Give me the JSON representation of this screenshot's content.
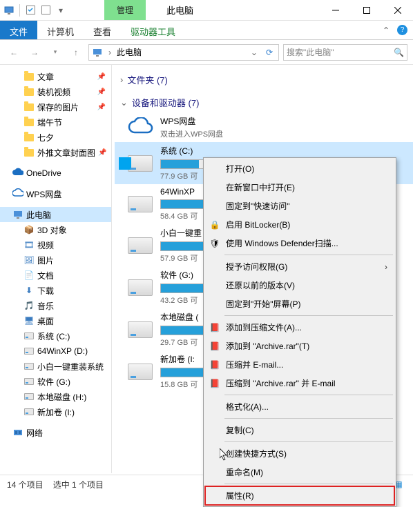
{
  "window": {
    "title": "此电脑",
    "manage_tab": "管理"
  },
  "ribbon": {
    "file": "文件",
    "computer": "计算机",
    "view": "查看",
    "tools": "驱动器工具"
  },
  "addr": {
    "path": "此电脑",
    "search_placeholder": "搜索\"此电脑\""
  },
  "tree": {
    "quick": [
      {
        "label": "文章",
        "pin": true
      },
      {
        "label": "装机视频",
        "pin": true
      },
      {
        "label": "保存的图片",
        "pin": true
      },
      {
        "label": "端午节"
      },
      {
        "label": "七夕"
      },
      {
        "label": "外推文章封面图",
        "pin": true
      }
    ],
    "onedrive": "OneDrive",
    "wps": "WPS网盘",
    "thispc": "此电脑",
    "thispc_children": [
      "3D 对象",
      "视频",
      "图片",
      "文档",
      "下载",
      "音乐",
      "桌面",
      "系统 (C:)",
      "64WinXP  (D:)",
      "小白一键重装系统",
      "软件 (G:)",
      "本地磁盘 (H:)",
      "新加卷 (I:)"
    ],
    "network": "网络"
  },
  "sections": {
    "folders": "文件夹 (7)",
    "drives": "设备和驱动器 (7)"
  },
  "wps_entry": {
    "title": "WPS网盘",
    "sub": "双击进入WPS网盘"
  },
  "drives": [
    {
      "title": "系统 (C:)",
      "sub": "77.9 GB 可",
      "fill": 35,
      "selected": true,
      "win": true
    },
    {
      "title": "64WinXP",
      "sub": "58.4 GB 可",
      "fill": 40
    },
    {
      "title": "小白一键重",
      "sub": "57.9 GB 可",
      "fill": 42
    },
    {
      "title": "软件 (G:)",
      "sub": "43.2 GB 可",
      "fill": 55
    },
    {
      "title": "本地磁盘 (",
      "sub": "29.7 GB 可",
      "fill": 68
    },
    {
      "title": "新加卷 (I:",
      "sub": "15.8 GB 可",
      "fill": 82
    }
  ],
  "context_menu": [
    {
      "label": "打开(O)"
    },
    {
      "label": "在新窗口中打开(E)"
    },
    {
      "label": "固定到\"快速访问\""
    },
    {
      "label": "启用 BitLocker(B)",
      "icon": "bitlocker"
    },
    {
      "label": "使用 Windows Defender扫描...",
      "icon": "defender"
    },
    {
      "sep": true
    },
    {
      "label": "授予访问权限(G)",
      "arrow": true
    },
    {
      "label": "还原以前的版本(V)"
    },
    {
      "label": "固定到\"开始\"屏幕(P)"
    },
    {
      "sep": true
    },
    {
      "label": "添加到压缩文件(A)...",
      "icon": "rar"
    },
    {
      "label": "添加到 \"Archive.rar\"(T)",
      "icon": "rar"
    },
    {
      "label": "压缩并 E-mail...",
      "icon": "rar"
    },
    {
      "label": "压缩到 \"Archive.rar\" 并 E-mail",
      "icon": "rar"
    },
    {
      "sep": true
    },
    {
      "label": "格式化(A)..."
    },
    {
      "sep": true
    },
    {
      "label": "复制(C)"
    },
    {
      "sep": true
    },
    {
      "label": "创建快捷方式(S)"
    },
    {
      "label": "重命名(M)"
    },
    {
      "sep": true
    },
    {
      "label": "属性(R)",
      "highlighted": true
    }
  ],
  "status": {
    "items": "14 个项目",
    "selected": "选中 1 个项目"
  }
}
